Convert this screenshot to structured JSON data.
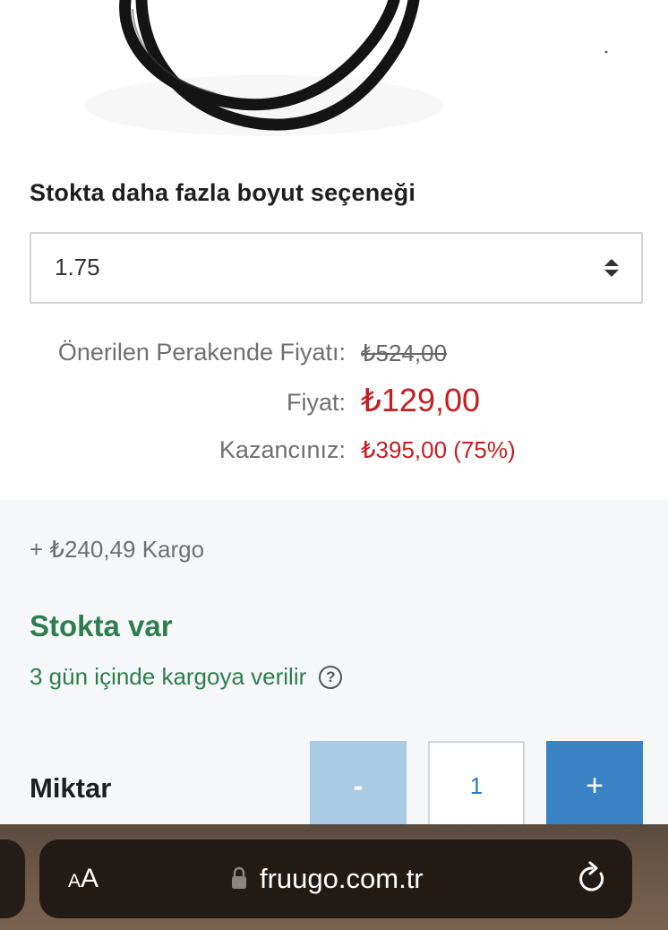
{
  "product": {
    "image_alt": ""
  },
  "size_option": {
    "label": "Stokta daha fazla boyut seçeneği",
    "selected": "1.75"
  },
  "pricing": {
    "rrp_label": "Önerilen Perakende Fiyatı:",
    "rrp_value": "₺524,00",
    "price_label": "Fiyat:",
    "price_value": "₺129,00",
    "savings_label": "Kazancınız:",
    "savings_value": "₺395,00 (75%)"
  },
  "delivery": {
    "shipping": "+ ₺240,49 Kargo",
    "stock_status": "Stokta var",
    "dispatch_text": "3 gün içinde kargoya verilir",
    "help_icon": "question-circle-icon"
  },
  "quantity": {
    "label": "Miktar",
    "minus": "-",
    "value": "1",
    "plus": "+"
  },
  "browser": {
    "aa_small": "A",
    "aa_large": "A",
    "url": "fruugo.com.tr",
    "lock_icon": "lock-icon",
    "reload_icon": "reload-icon"
  },
  "colors": {
    "price_red": "#c41e22",
    "stock_green": "#2e7d4f",
    "minus_button": "#a9cbe3",
    "plus_button": "#3a82c3",
    "quantity_text": "#2f7bbf"
  }
}
